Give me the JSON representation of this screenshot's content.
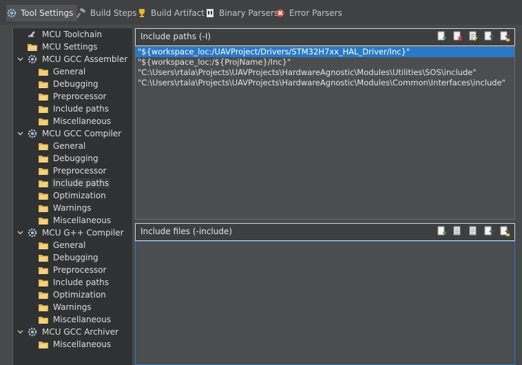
{
  "tabs": [
    {
      "label": "Tool Settings",
      "icon": "gear-icon",
      "active": true
    },
    {
      "label": "Build Steps",
      "icon": "hammer-icon",
      "active": false
    },
    {
      "label": "Build Artifact",
      "icon": "trophy-icon",
      "active": false
    },
    {
      "label": "Binary Parsers",
      "icon": "binary-icon",
      "active": false
    },
    {
      "label": "Error Parsers",
      "icon": "error-icon",
      "active": false
    }
  ],
  "tree": {
    "toolchain": "MCU Toolchain",
    "settings": "MCU Settings",
    "assembler": {
      "label": "MCU GCC Assembler",
      "children": [
        "General",
        "Debugging",
        "Preprocessor",
        "Include paths",
        "Miscellaneous"
      ]
    },
    "compiler": {
      "label": "MCU GCC Compiler",
      "children": [
        "General",
        "Debugging",
        "Preprocessor",
        "Include paths",
        "Optimization",
        "Warnings",
        "Miscellaneous"
      ]
    },
    "gpp": {
      "label": "MCU G++ Compiler",
      "children": [
        "General",
        "Debugging",
        "Preprocessor",
        "Include paths",
        "Optimization",
        "Warnings",
        "Miscellaneous"
      ]
    },
    "archiver": {
      "label": "MCU GCC Archiver",
      "children": [
        "Miscellaneous"
      ]
    }
  },
  "include_paths": {
    "title": "Include paths (-I)",
    "items": [
      "\"${workspace_loc:/UAVProject/Drivers/STM32H7xx_HAL_Driver/Inc}\"",
      "\"${workspace_loc:/${ProjName}/Inc}\"",
      "\"C:\\Users\\rtala\\Projects\\UAVProjects\\HardwareAgnostic\\Modules\\Utilities\\SOS\\include\"",
      "\"C:\\Users\\rtala\\Projects\\UAVProjects\\HardwareAgnostic\\Modules\\Common\\Interfaces\\include\""
    ]
  },
  "include_files": {
    "title": "Include files (-include)",
    "items": []
  },
  "colors": {
    "selection": "#2a79c8",
    "tree_background": "#2f3133",
    "panel_background": "#4b4d4f",
    "folder": "#e8b851"
  }
}
